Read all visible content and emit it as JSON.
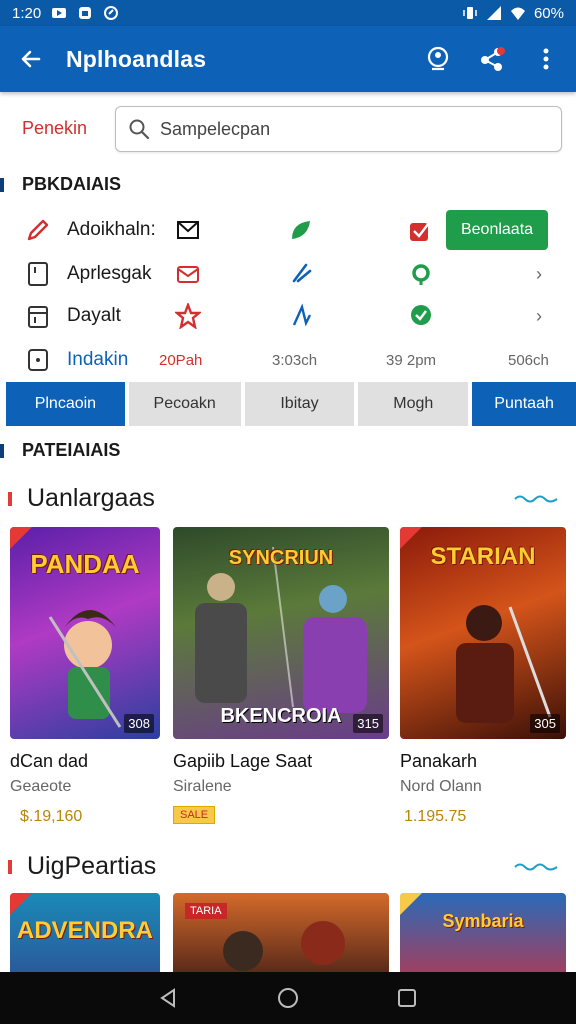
{
  "statusbar": {
    "time": "1:20",
    "battery": "60%",
    "colors": {
      "bg": "#0b5aa8"
    }
  },
  "appbar": {
    "title": "Nplhoandlas",
    "colors": {
      "bg": "#0d62b8"
    }
  },
  "search": {
    "label": "Penekin",
    "placeholder": "Sampelecpan"
  },
  "section1": {
    "title": "PBKDAIAIS"
  },
  "grid": {
    "rows": [
      {
        "label": "Adoikhaln:",
        "icon": "pen-icon"
      },
      {
        "label": "Aprlesgak",
        "icon": "tablet-icon"
      },
      {
        "label": "Dayalt",
        "icon": "calendar-icon"
      },
      {
        "label": "Indakin",
        "icon": "clock-icon"
      }
    ],
    "green_button": "Beonlaata",
    "times": [
      "20Pah",
      "3:03ch",
      "39 2pm",
      "506ch"
    ]
  },
  "tabs": [
    "Plncaoin",
    "Pecoakn",
    "Ibitay",
    "Mogh",
    "Puntaah"
  ],
  "section2": {
    "title": "PATEIAIAIS"
  },
  "list1": {
    "title": "Uanlargaas",
    "cards": [
      {
        "art_title": "PANDAA",
        "count": "308",
        "name": "dCan dad",
        "sub": "Geaeote",
        "price": "$.19,160"
      },
      {
        "art_title": "BKENCROIA",
        "count": "315",
        "name": "Gapiib Lage Saat",
        "sub": "Siralene",
        "price": "SALE"
      },
      {
        "art_title": "STARIAN",
        "count": "305",
        "name": "Panakarh",
        "sub": "Nord Olann",
        "price": "1.195.75"
      }
    ]
  },
  "list2": {
    "title": "UigPeartias",
    "cards": [
      {
        "art_title": "ADVENDRA"
      },
      {
        "art_title": "TARIA"
      },
      {
        "art_title": "Symbaria"
      }
    ]
  }
}
